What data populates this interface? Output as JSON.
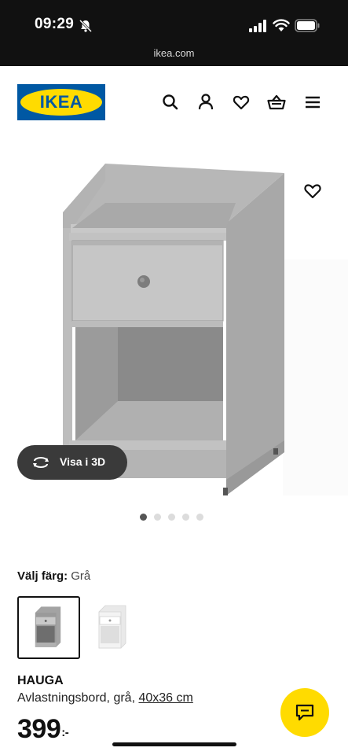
{
  "status_bar": {
    "time": "09:29",
    "icons": [
      "bell-slash-icon",
      "cellular-signal-icon",
      "wifi-icon",
      "battery-icon"
    ],
    "url": "ikea.com"
  },
  "header": {
    "logo_text": "IKEA",
    "icons": [
      "search-icon",
      "account-icon",
      "favorites-icon",
      "basket-icon",
      "menu-icon"
    ],
    "brand_blue": "#0058a3",
    "brand_yellow": "#ffdb00"
  },
  "gallery": {
    "view_3d_label": "Visa i 3D",
    "image_count": 5,
    "active_index": 0
  },
  "color_select": {
    "label": "Välj färg:",
    "value": "Grå",
    "options": [
      {
        "color": "#9b9b9b",
        "selected": true
      },
      {
        "color": "#f2f2f2",
        "selected": false
      }
    ]
  },
  "product": {
    "name": "HAUGA",
    "description": "Avlastningsbord, grå,",
    "size": "40x36 cm",
    "price": "399",
    "price_suffix": ":-"
  }
}
